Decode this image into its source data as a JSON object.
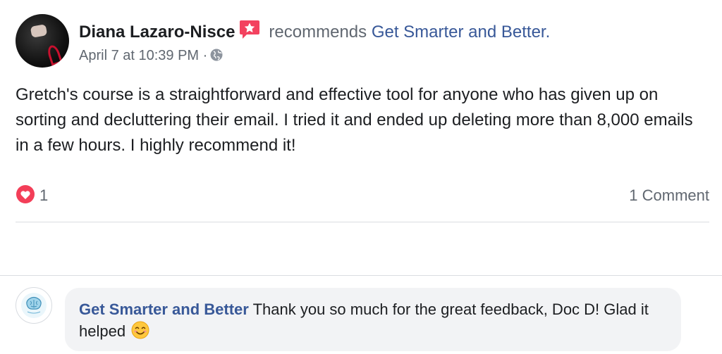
{
  "post": {
    "author": "Diana Lazaro-Nisce",
    "verb": "recommends",
    "page": "Get Smarter and Better.",
    "timestamp": "April 7 at 10:39 PM",
    "separator": "·",
    "body": "Gretch's course is a straightforward and effective tool for anyone who has given up on sorting and decluttering their email. I tried it and ended up deleting more than 8,000 emails in a few hours. I highly recommend it!",
    "reaction_count": "1",
    "comments_label": "1 Comment"
  },
  "comment": {
    "author": "Get Smarter and Better",
    "text": "Thank you so much for the great feedback, Doc D! Glad it helped"
  },
  "colors": {
    "link": "#385898",
    "recommend_badge": "#f3425f",
    "love": "#f33e58",
    "bubble_bg": "#f2f3f5"
  },
  "icons": {
    "recommend": "recommend-badge-icon",
    "privacy": "globe-icon",
    "reaction": "love-reaction-icon",
    "emoji": "smiling-face-emoji"
  }
}
